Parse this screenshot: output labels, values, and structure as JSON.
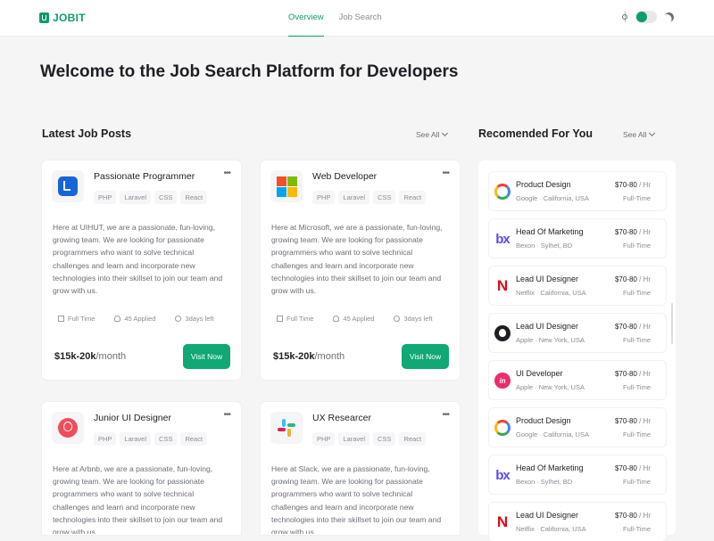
{
  "header": {
    "brand": "JOBIT",
    "nav": [
      "Overview",
      "Job Search"
    ]
  },
  "page": {
    "title": "Welcome to the Job Search Platform for Developers"
  },
  "latest": {
    "title": "Latest Job Posts",
    "see_all": "See All",
    "jobs": [
      {
        "title": "Passionate Programmer",
        "logo": "uihut-logo",
        "tags": [
          "PHP",
          "Laravel",
          "CSS",
          "React"
        ],
        "desc": "Here at UIHUT, we are a passionate, fun-loving, growing team. We are looking for passionate programmers who want to solve technical challenges and learn and incorporate new technologies into their skillset to join our team and grow with us.",
        "type": "Full Time",
        "applied": "45 Applied",
        "left": "3days left",
        "price": "$15k-20k",
        "price_unit": "/month",
        "cta": "Visit Now"
      },
      {
        "title": "Web Developer",
        "logo": "microsoft-logo",
        "tags": [
          "PHP",
          "Laravel",
          "CSS",
          "React"
        ],
        "desc": "Here at Microsoft, we are a passionate, fun-loving, growing team. We are looking for passionate programmers who want to solve technical challenges and learn and incorporate new technologies into their skillset to join our team and grow with us.",
        "type": "Full Time",
        "applied": "45 Applied",
        "left": "3days left",
        "price": "$15k-20k",
        "price_unit": "/month",
        "cta": "Visit Now"
      },
      {
        "title": "Junior UI Designer",
        "logo": "airbnb-logo",
        "tags": [
          "PHP",
          "Laravel",
          "CSS",
          "React"
        ],
        "desc": "Here at Arbnb, we are a passionate, fun-loving, growing team. We are looking for passionate programmers who want to solve technical challenges and learn and incorporate new technologies into their skillset to join our team and grow with us."
      },
      {
        "title": "UX Researcer",
        "logo": "slack-logo",
        "tags": [
          "PHP",
          "Laravel",
          "CSS",
          "React"
        ],
        "desc": "Here at Slack, we are a passionate, fun-loving, growing team. We are looking for passionate programmers who want to solve technical challenges and learn and incorporate new technologies into their skillset to join our team and grow with us."
      }
    ]
  },
  "recommended": {
    "title": "Recomended For You",
    "see_all": "See All",
    "items": [
      {
        "title": "Product Design",
        "company": "Google",
        "location": "California, USA",
        "pay": "$70-80",
        "unit": " / Hr",
        "type": "Full-Time",
        "logo": "google-logo"
      },
      {
        "title": "Head Of Marketing",
        "company": "Bexon",
        "location": "Sylhet, BD",
        "pay": "$70-80",
        "unit": " / Hr",
        "type": "Full-Time",
        "logo": "bexon-logo"
      },
      {
        "title": "Lead UI Designer",
        "company": "Netflix",
        "location": "California, USA",
        "pay": "$70-80",
        "unit": " / Hr",
        "type": "Full-Time",
        "logo": "netflix-logo"
      },
      {
        "title": "Lead UI Designer",
        "company": "Apple",
        "location": "New York, USA",
        "pay": "$70-80",
        "unit": " / Hr",
        "type": "Full-Time",
        "logo": "apple-logo"
      },
      {
        "title": "UI Developer",
        "company": "Apple",
        "location": "New York, USA",
        "pay": "$70-80",
        "unit": " / Hr",
        "type": "Full-Time",
        "logo": "invision-logo"
      },
      {
        "title": "Product Design",
        "company": "Google",
        "location": "California, USA",
        "pay": "$70-80",
        "unit": " / Hr",
        "type": "Full-Time",
        "logo": "google-logo"
      },
      {
        "title": "Head Of Marketing",
        "company": "Bexon",
        "location": "Sylhet, BD",
        "pay": "$70-80",
        "unit": " / Hr",
        "type": "Full-Time",
        "logo": "bexon-logo"
      },
      {
        "title": "Lead UI Designer",
        "company": "Netflix",
        "location": "California, USA",
        "pay": "$70-80",
        "unit": " / Hr",
        "type": "Full-Time",
        "logo": "netflix-logo"
      }
    ]
  },
  "colors": {
    "accent": "#0f9d6e",
    "button": "#10a874",
    "background": "#f5f5f6"
  }
}
